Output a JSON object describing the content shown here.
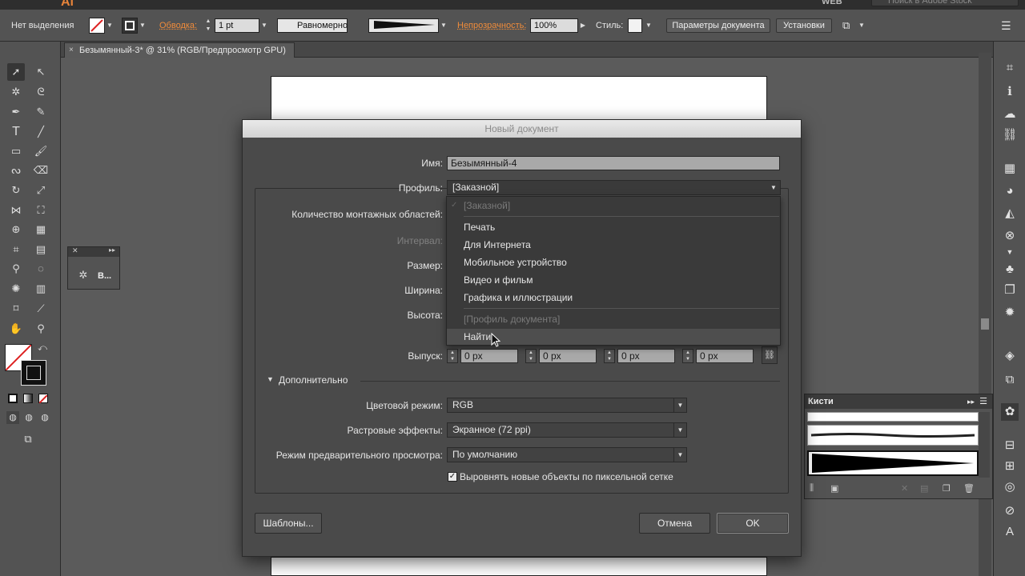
{
  "app": {
    "logo": "Ai",
    "workspace": "WEB",
    "stock_placeholder": "Поиск в Adobe Stock"
  },
  "control_bar": {
    "selection": "Нет выделения",
    "stroke_label": "Обводка:",
    "stroke_weight": "1 pt",
    "profile": "Равномерно",
    "opacity_label": "Непрозрачность:",
    "opacity_value": "100%",
    "style_label": "Стиль:",
    "doc_setup": "Параметры документа",
    "preferences": "Установки"
  },
  "doc_tab": {
    "title": "Безымянный-3* @ 31% (RGB/Предпросмотр GPU)",
    "close": "×"
  },
  "mini_panel": {
    "label": "В..."
  },
  "brushes_panel": {
    "title": "Кисти"
  },
  "dialog": {
    "title": "Новый документ",
    "name_label": "Имя:",
    "name_value": "Безымянный-4",
    "profile_label": "Профиль:",
    "profile_value": "[Заказной]",
    "artboards_label": "Количество монтажных областей:",
    "spacing_label": "Интервал:",
    "size_label": "Размер:",
    "width_label": "Ширина:",
    "height_label": "Высота:",
    "bleed_label": "Выпуск:",
    "bleed_values": [
      "0 px",
      "0 px",
      "0 px",
      "0 px"
    ],
    "advanced_label": "Дополнительно",
    "color_mode_label": "Цветовой режим:",
    "color_mode_value": "RGB",
    "raster_label": "Растровые эффекты:",
    "raster_value": "Экранное (72 ppi)",
    "preview_label": "Режим предварительного просмотра:",
    "preview_value": "По умолчанию",
    "align_label": "Выровнять новые объекты по пиксельной сетке",
    "align_checked": true,
    "templates_button": "Шаблоны...",
    "cancel_button": "Отмена",
    "ok_button": "OK"
  },
  "profile_dropdown": {
    "items": [
      {
        "label": "[Заказной]",
        "enabled": false,
        "checked": true
      },
      {
        "label": "Печать",
        "enabled": true
      },
      {
        "label": "Для Интернета",
        "enabled": true
      },
      {
        "label": "Мобильное устройство",
        "enabled": true
      },
      {
        "label": "Видео и фильм",
        "enabled": true
      },
      {
        "label": "Графика и иллюстрации",
        "enabled": true
      },
      {
        "label": "[Профиль документа]",
        "enabled": false
      },
      {
        "label": "Найти...",
        "enabled": true,
        "hovered": true
      }
    ]
  },
  "colors": {
    "accent_orange": "#f08c3a",
    "dialog_bg": "#4a4a4a",
    "ui_bg": "#535353"
  }
}
